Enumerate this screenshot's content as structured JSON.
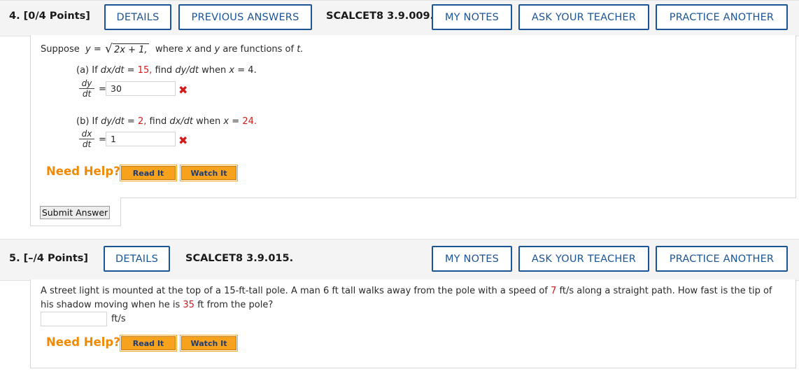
{
  "q4": {
    "header": "4. [0/4 Points]",
    "buttons": {
      "details": "DETAILS",
      "previous": "PREVIOUS ANSWERS",
      "notes": "MY NOTES",
      "ask": "ASK YOUR TEACHER",
      "practice": "PRACTICE ANOTHER"
    },
    "code": "SCALCET8 3.9.009.",
    "suppose_prefix": "Suppose",
    "y_var": "y",
    "equals": "=",
    "sqrt_expr": "2x + 1,",
    "suppose_suffix_1": "where",
    "x_var": "x",
    "and_word": "and",
    "suppose_suffix_2": "are functions of",
    "t_var": "t.",
    "part_a": {
      "label": "(a) If",
      "given": "dx/dt",
      "eq": "=",
      "given_val": "15,",
      "find": "find",
      "target": "dy/dt",
      "when": "when",
      "cond_var": "x",
      "cond_eq": "=",
      "cond_val": "4.",
      "frac_num": "dy",
      "frac_den": "dt",
      "answer": "30"
    },
    "part_b": {
      "label": "(b) If",
      "given": "dy/dt",
      "eq": "=",
      "given_val": "2,",
      "find": "find",
      "target": "dx/dt",
      "when": "when",
      "cond_var": "x",
      "cond_eq": "=",
      "cond_val": "24.",
      "frac_num": "dx",
      "frac_den": "dt",
      "answer": "1"
    },
    "need_help": "Need Help?",
    "read_it": "Read It",
    "watch_it": "Watch It",
    "submit": "Submit Answer"
  },
  "q5": {
    "header": "5. [–/4 Points]",
    "buttons": {
      "details": "DETAILS",
      "notes": "MY NOTES",
      "ask": "ASK YOUR TEACHER",
      "practice": "PRACTICE ANOTHER"
    },
    "code": "SCALCET8 3.9.015.",
    "text_1": "A street light is mounted at the top of a 15-ft-tall pole. A man 6 ft tall walks away from the pole with a speed of",
    "speed_val": "7",
    "text_2": "ft/s along a straight path. How fast is the tip of",
    "text_3": "his shadow moving when he is",
    "distance_val": "35",
    "text_4": "ft from the pole?",
    "answer": "",
    "unit": "ft/s",
    "need_help": "Need Help?",
    "read_it": "Read It",
    "watch_it": "Watch It"
  },
  "colors": {
    "accent": "#1b5596",
    "highlight_red": "#d11a1a",
    "help_orange": "#f08a00",
    "button_orange": "#f7a21d"
  },
  "icons": {
    "wrong": "x-mark-icon"
  }
}
